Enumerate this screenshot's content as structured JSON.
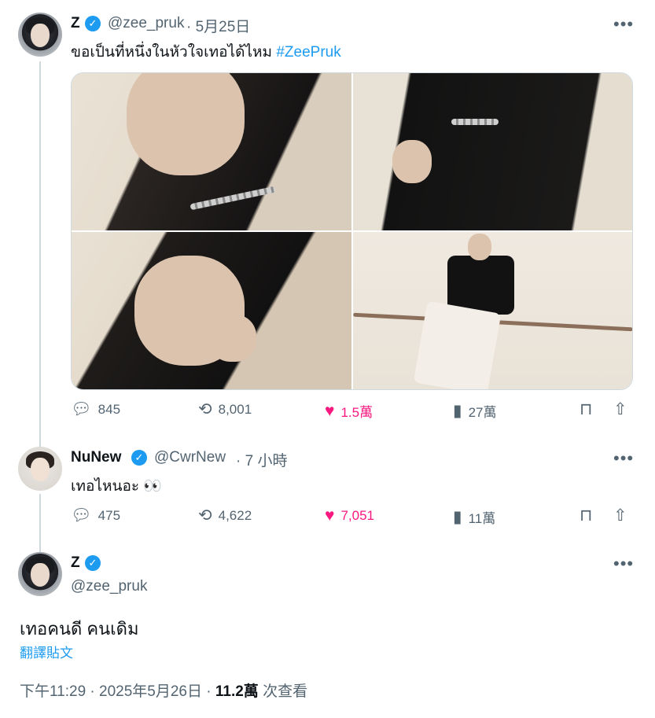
{
  "tweet1": {
    "name": "Z",
    "handle": "@zee_pruk",
    "date": "· 5月25日",
    "text": "ขอเป็นที่หนึ่งในหัวใจเทอได้ไหม ",
    "hashtag": "#ZeePruk",
    "stats": {
      "replies": "845",
      "retweets": "8,001",
      "likes": "1.5萬",
      "views": "27萬"
    }
  },
  "tweet2": {
    "name": "NuNew",
    "handle": "@CwrNew",
    "date": "· 7 小時",
    "text": "เทอไหนอะ 👀",
    "stats": {
      "replies": "475",
      "retweets": "4,622",
      "likes": "7,051",
      "views": "11萬"
    }
  },
  "tweet3": {
    "name": "Z",
    "handle": "@zee_pruk",
    "text": "เทอคนดี คนเดิม",
    "translate": "翻譯貼文",
    "time": "下午11:29 · 2025年5月26日 · ",
    "views_count": "11.2萬",
    "views_label": " 次查看"
  },
  "icons": {
    "more": "more-icon",
    "reply": "reply-icon",
    "retweet": "retweet-icon",
    "like": "heart-icon",
    "views": "analytics-icon",
    "bookmark": "bookmark-icon",
    "share": "share-icon",
    "verified": "verified-badge-icon"
  },
  "colors": {
    "accent": "#1d9bf0",
    "like": "#f91880",
    "muted": "#536471"
  }
}
